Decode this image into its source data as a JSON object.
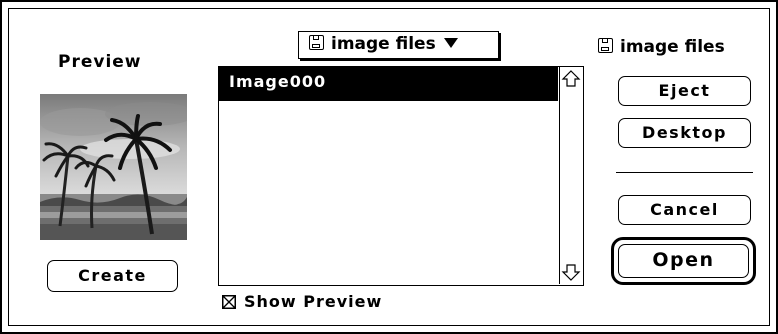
{
  "preview": {
    "label": "Preview",
    "create_label": "Create",
    "image_description_icon": "palm-trees-beach-thumbnail"
  },
  "folder_popup": {
    "selected": "image files",
    "icon": "floppy-disk-icon"
  },
  "file_list": {
    "items": [
      {
        "name": "Image000",
        "selected": true
      }
    ]
  },
  "show_preview": {
    "label": "Show Preview",
    "checked": true
  },
  "volume": {
    "name": "image files",
    "icon": "floppy-disk-icon"
  },
  "buttons": {
    "eject": "Eject",
    "desktop": "Desktop",
    "cancel": "Cancel",
    "open": "Open"
  },
  "colors": {
    "selection_bg": "#000000",
    "selection_fg": "#ffffff",
    "background": "#ffffff"
  }
}
